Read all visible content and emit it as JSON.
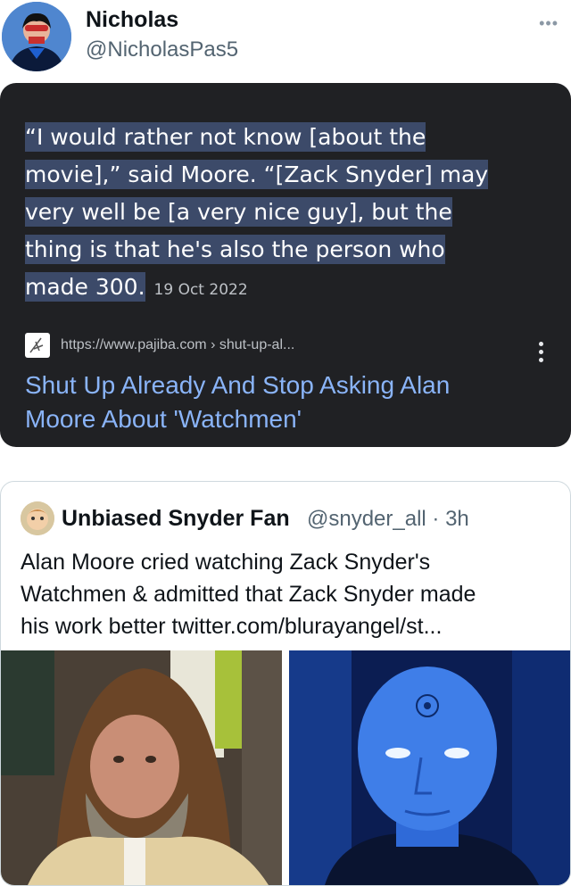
{
  "author": {
    "name": "Nicholas",
    "handle": "@NicholasPas5",
    "more_label": "•••"
  },
  "search_result": {
    "snippet_lines": [
      "“I would rather not know [about the",
      "movie],” said Moore. “[Zack Snyder] may",
      "very well be [a very nice guy], but the",
      "thing is that he's also the person who",
      "made 300."
    ],
    "date": "19 Oct 2022",
    "url": "https://www.pajiba.com › shut-up-al...",
    "title_lines": [
      "Shut Up Already And Stop Asking Alan",
      "Moore About 'Watchmen'"
    ]
  },
  "quoted_tweet": {
    "name": "Unbiased Snyder Fan",
    "handle_time": "@snyder_all · 3h",
    "text_lines": [
      "Alan Moore cried watching Zack Snyder's",
      "Watchmen & admitted that Zack Snyder made",
      "his work better twitter.com/blurayangel/st..."
    ]
  },
  "colors": {
    "dark_bg": "#202124",
    "highlight": "#3c4a69",
    "link_blue": "#8ab4f8",
    "secondary_text": "#536471"
  }
}
